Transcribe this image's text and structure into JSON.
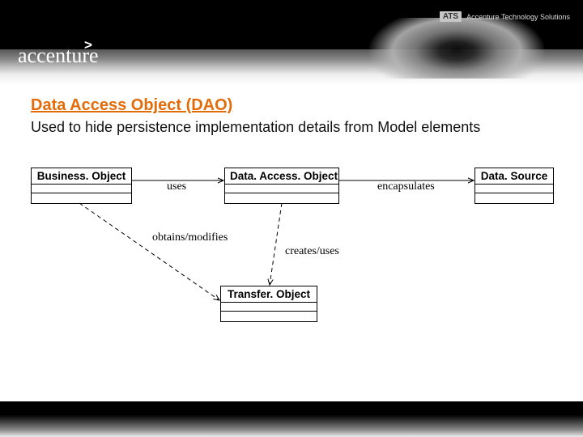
{
  "header": {
    "brand": "accenture",
    "chevron": ">",
    "ats_label": "ATS",
    "ats_text": "Accenture Technology Solutions"
  },
  "page": {
    "title": "Data Access Object (DAO)",
    "subtitle": "Used to hide persistence implementation details from Model elements"
  },
  "diagram": {
    "nodes": {
      "business_object": "Business. Object",
      "data_access_object": "Data. Access. Object",
      "data_source": "Data. Source",
      "transfer_object": "Transfer. Object"
    },
    "edges": {
      "bo_dao": "uses",
      "dao_ds": "encapsulates",
      "bo_to": "obtains/modifies",
      "dao_to": "creates/uses"
    }
  }
}
